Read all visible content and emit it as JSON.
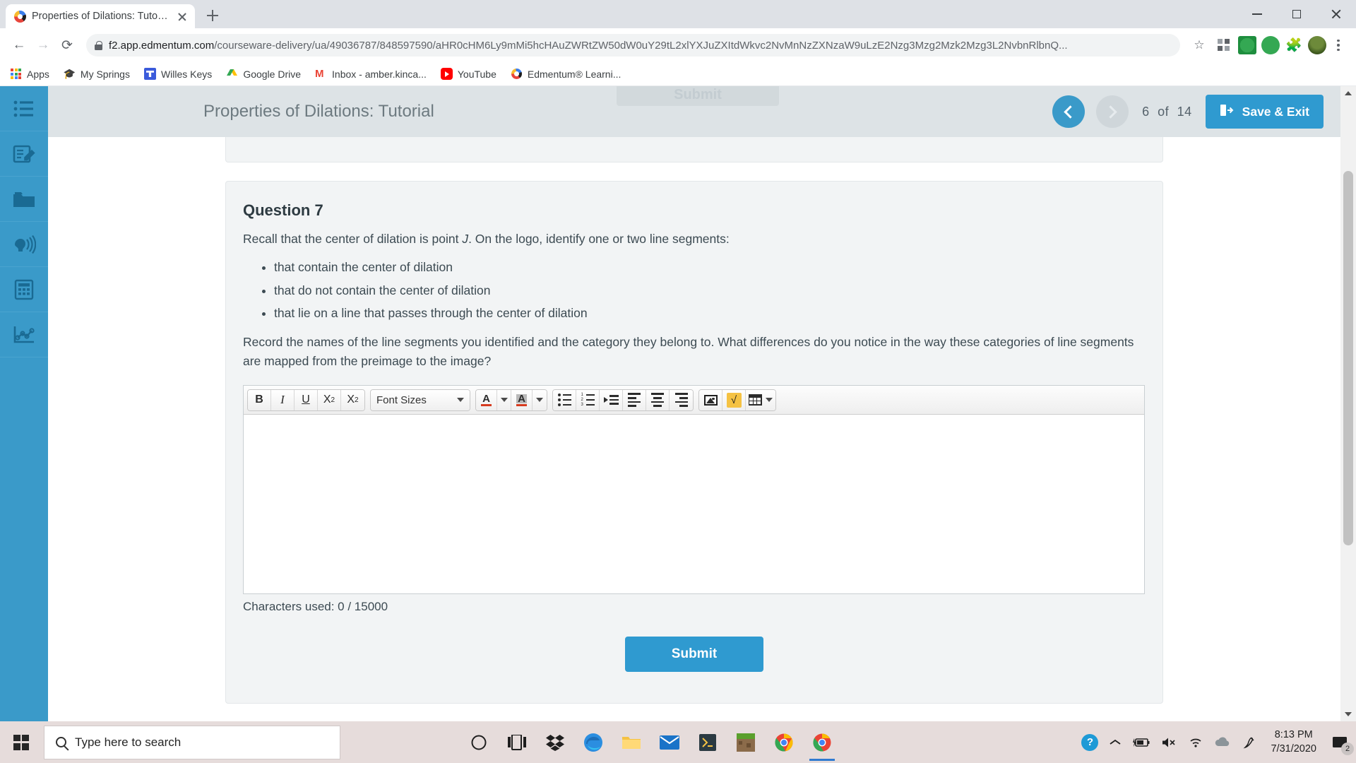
{
  "browser": {
    "tab": {
      "title": "Properties of Dilations: Tutorial",
      "favicon": "edmentum-e-icon",
      "close": "close-icon"
    },
    "newtab_label": "+",
    "window_controls": {
      "minimize": "minimize-icon",
      "maximize": "maximize-icon",
      "close": "close-icon"
    },
    "nav": {
      "back": "back-arrow-icon",
      "forward": "forward-arrow-icon",
      "reload": "reload-icon"
    },
    "omnibox": {
      "lock": "lock-icon",
      "host": "f2.app.edmentum.com",
      "path": "/courseware-delivery/ua/49036787/848597590/aHR0cHM6Ly9mMi5hcHAuZWRtZW50dW0uY29tL2xlYXJuZXItdWktc2NvPnZ25tZW50Mzg3L2Nvbnhh...",
      "path_display": "/courseware-delivery/ua/49036787/848597590/aHR0cHM6Ly9mMi5hcHAuZWRtZW50dW0uY29tL2xlYXJuZXItdWkvc2NvMnNzZXNzaW9uLzE2Nzg3Mzg2Mzk2Mzg3L2NvbnRlbnQ...",
      "star": "bookmark-star-icon"
    },
    "extensions": [
      {
        "name": "extension-grid-icon"
      },
      {
        "name": "grammarly-icon"
      },
      {
        "name": "status-dot-icon"
      },
      {
        "name": "puzzle-extensions-icon"
      },
      {
        "name": "profile-avatar-icon"
      },
      {
        "name": "chrome-menu-icon"
      }
    ],
    "bookmarks": [
      {
        "label": "Apps",
        "icon": "apps-grid-icon"
      },
      {
        "label": "My Springs",
        "icon": "graduation-cap-icon"
      },
      {
        "label": "Willes Keys",
        "icon": "willes-keys-icon"
      },
      {
        "label": "Google Drive",
        "icon": "google-drive-icon"
      },
      {
        "label": "Inbox - amber.kinca...",
        "icon": "gmail-icon"
      },
      {
        "label": "YouTube",
        "icon": "youtube-icon"
      },
      {
        "label": "Edmentum® Learni...",
        "icon": "edmentum-e-icon"
      }
    ]
  },
  "sidebar": {
    "items": [
      {
        "name": "sidebar-item-outline",
        "icon": "list-outline-icon"
      },
      {
        "name": "sidebar-item-notes",
        "icon": "notes-pencil-icon"
      },
      {
        "name": "sidebar-item-resources",
        "icon": "folder-icon"
      },
      {
        "name": "sidebar-item-text-to-speech",
        "icon": "text-to-speech-icon"
      },
      {
        "name": "sidebar-item-calculator",
        "icon": "calculator-icon"
      },
      {
        "name": "sidebar-item-graphing-tool",
        "icon": "line-graph-icon"
      }
    ]
  },
  "header": {
    "title": "Properties of Dilations: Tutorial",
    "ghost_submit_label": "Submit",
    "prev_label": "prev-arrow-icon",
    "next_label": "next-arrow-icon",
    "page_current": "6",
    "page_separator": "of",
    "page_total": "14",
    "save_exit_label": "Save & Exit",
    "save_exit_icon": "exit-door-icon"
  },
  "question": {
    "title": "Question 7",
    "intro_before": "Recall that the center of dilation is point ",
    "intro_variable": "J",
    "intro_after": ". On the logo, identify one or two line segments:",
    "bullets": [
      "that contain the center of dilation",
      "that do not contain the center of dilation",
      "that lie on a line that passes through the center of dilation"
    ],
    "paragraph": "Record the names of the line segments you identified and the category they belong to. What differences do you notice in the way these categories of line segments are mapped from the preimage to the image?"
  },
  "editor": {
    "toolbar": {
      "bold": "B",
      "italic": "I",
      "underline": "U",
      "superscript_base": "X",
      "superscript_exp": "2",
      "subscript_base": "X",
      "subscript_exp": "2",
      "font_sizes_label": "Font Sizes",
      "text_color": "A",
      "highlight_color": "A",
      "icons": [
        "bold-icon",
        "italic-icon",
        "underline-icon",
        "superscript-icon",
        "subscript-icon",
        "font-sizes-dropdown",
        "text-color-icon",
        "highlight-color-icon",
        "bullet-list-icon",
        "numbered-list-icon",
        "indent-icon",
        "align-left-icon",
        "align-center-icon",
        "align-right-icon",
        "insert-image-icon",
        "math-equation-icon",
        "insert-table-icon"
      ]
    },
    "body_value": "",
    "body_placeholder": "",
    "char_count_label": "Characters used: 0 / 15000"
  },
  "submit": {
    "label": "Submit"
  },
  "taskbar": {
    "start_icon": "windows-logo-icon",
    "search_placeholder": "Type here to search",
    "search_icon": "search-icon",
    "apps": [
      {
        "name": "cortana-icon"
      },
      {
        "name": "task-view-icon"
      },
      {
        "name": "dropbox-icon"
      },
      {
        "name": "microsoft-edge-icon"
      },
      {
        "name": "file-explorer-icon"
      },
      {
        "name": "mail-icon"
      },
      {
        "name": "sublime-text-icon"
      },
      {
        "name": "minecraft-icon"
      },
      {
        "name": "google-chrome-icon"
      },
      {
        "name": "google-chrome-active-icon"
      }
    ],
    "tray": [
      {
        "name": "help-support-icon"
      },
      {
        "name": "show-hidden-icons-icon"
      },
      {
        "name": "battery-charging-icon"
      },
      {
        "name": "volume-muted-icon"
      },
      {
        "name": "wifi-icon"
      },
      {
        "name": "onedrive-icon"
      },
      {
        "name": "pen-workspace-icon"
      }
    ],
    "clock_time": "8:13 PM",
    "clock_date": "7/31/2020",
    "notification_count": "2",
    "notification_icon": "action-center-icon"
  },
  "colors": {
    "accent_blue": "#2f9ad0",
    "sidebar_blue": "#3a9ac9",
    "header_gray": "#dde3e6",
    "card_gray": "#f2f4f5",
    "taskbar": "#e6dcdb"
  }
}
